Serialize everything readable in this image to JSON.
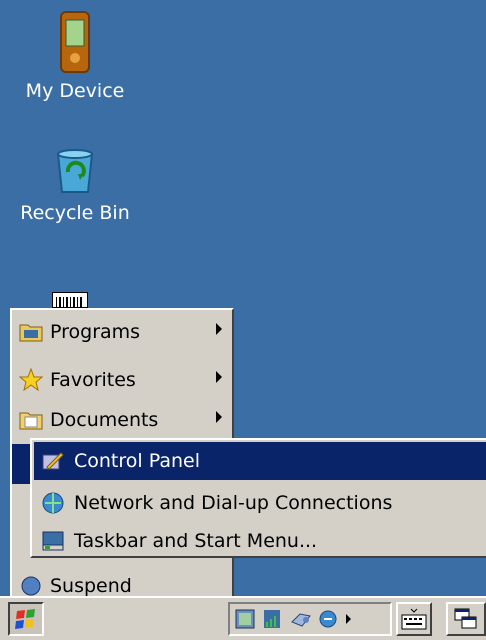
{
  "desktop": {
    "icons": [
      {
        "label": "My Device",
        "icon": "pda-device-icon"
      },
      {
        "label": "Recycle Bin",
        "icon": "recycle-bin-icon"
      }
    ]
  },
  "start_menu": {
    "items": [
      {
        "label": "Programs",
        "icon": "programs-folder-icon",
        "has_submenu": true
      },
      {
        "label": "Favorites",
        "icon": "favorites-star-icon",
        "has_submenu": true
      },
      {
        "label": "Documents",
        "icon": "documents-folder-icon",
        "has_submenu": true
      },
      {
        "label": "Suspend",
        "icon": "suspend-icon",
        "has_submenu": false
      }
    ]
  },
  "settings_submenu": {
    "items": [
      {
        "label": "Control Panel",
        "icon": "control-panel-icon",
        "selected": true
      },
      {
        "label": "Network and Dial-up Connections",
        "icon": "network-icon",
        "selected": false
      },
      {
        "label": "Taskbar and Start Menu...",
        "icon": "taskbar-icon",
        "selected": false
      }
    ]
  },
  "taskbar": {
    "tray_icons": [
      "scanner-icon",
      "signal-icon",
      "connection-icon",
      "ie-icon"
    ],
    "buttons": [
      "keyboard-icon",
      "windows-switch-icon"
    ]
  },
  "colors": {
    "desktop": "#3a6ea5",
    "highlight": "#0a246a",
    "face": "#d4d0c8"
  }
}
